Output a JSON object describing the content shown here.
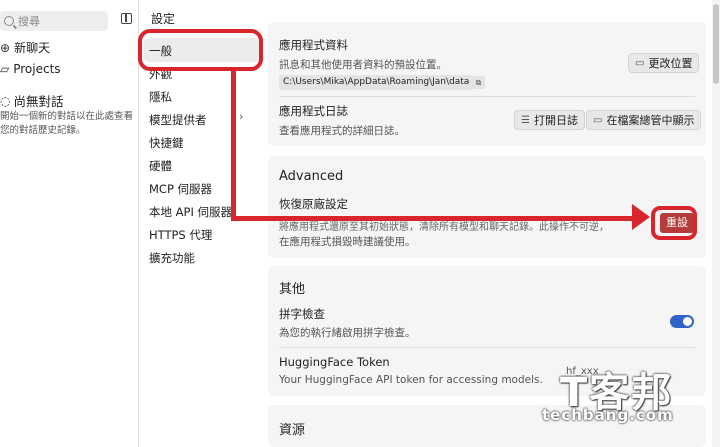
{
  "sidebar": {
    "search_placeholder": "搜尋",
    "new_chat": "新聊天",
    "projects": "Projects",
    "no_conversations_title": "尚無對話",
    "no_conversations_desc": "開始一個新的對話以在此處查看您的對話歷史記錄。"
  },
  "header": {
    "title": "設定"
  },
  "nav": {
    "items": [
      "一般",
      "外觀",
      "隱私",
      "模型提供者",
      "快捷鍵",
      "硬體",
      "MCP 伺服器",
      "本地 API 伺服器",
      "HTTPS 代理",
      "擴充功能"
    ]
  },
  "app_data": {
    "title": "應用程式資料",
    "desc": "訊息和其他使用者資料的預設位置。",
    "path": "C:\\Users\\Mika\\AppData\\Roaming\\Jan\\data",
    "change_button": "更改位置"
  },
  "app_logs": {
    "title": "應用程式日誌",
    "desc": "查看應用程式的詳細日誌。",
    "open_button": "打開日誌",
    "explorer_button": "在檔案總管中顯示"
  },
  "advanced": {
    "section_title": "Advanced",
    "factory_title": "恢復原廠設定",
    "factory_desc_line1": "將應用程式還原至其初始狀態，清除所有模型和聊天記錄。此操作不可逆，",
    "factory_desc_line2": "在應用程式損毀時建議使用。",
    "reset_button": "重設"
  },
  "other": {
    "section_title": "其他",
    "spell_title": "拼字檢查",
    "spell_desc": "為您的執行緒啟用拼字檢查。",
    "spell_enabled": true,
    "hf_title": "HuggingFace Token",
    "hf_desc": "Your HuggingFace API token for accessing models.",
    "hf_value": "hf_xxx"
  },
  "resources": {
    "section_title": "資源"
  },
  "watermark": {
    "logo": "T客邦",
    "site": "techbang.com"
  },
  "colors": {
    "annotation": "#d9262c",
    "reset": "#b53a3a",
    "toggle": "#2f63c8"
  }
}
